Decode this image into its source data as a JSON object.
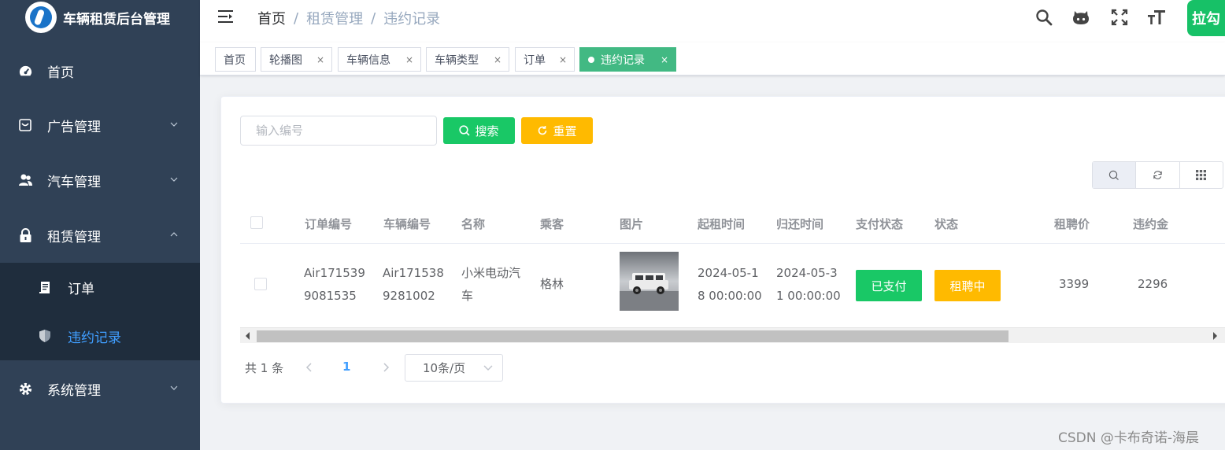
{
  "app": {
    "title": "车辆租赁后台管理"
  },
  "sidebar": {
    "items": [
      {
        "label": "首页",
        "icon": "dashboard-icon"
      },
      {
        "label": "广告管理",
        "icon": "ad-icon"
      },
      {
        "label": "汽车管理",
        "icon": "people-icon"
      },
      {
        "label": "租赁管理",
        "icon": "lock-icon",
        "expanded": true
      },
      {
        "label": "系统管理",
        "icon": "gear-icon"
      }
    ],
    "submenu": [
      {
        "label": "订单",
        "icon": "document-icon"
      },
      {
        "label": "违约记录",
        "icon": "shield-icon",
        "active": true
      }
    ]
  },
  "header": {
    "breadcrumb": [
      "首页",
      "租赁管理",
      "违约记录"
    ],
    "icons": [
      "search-icon",
      "github-icon",
      "fullscreen-icon",
      "font-size-icon"
    ],
    "avatar_text": "拉勾"
  },
  "tags": [
    {
      "label": "首页",
      "closable": false
    },
    {
      "label": "轮播图",
      "closable": true
    },
    {
      "label": "车辆信息",
      "closable": true
    },
    {
      "label": "车辆类型",
      "closable": true
    },
    {
      "label": "订单",
      "closable": true
    },
    {
      "label": "违约记录",
      "closable": true,
      "active": true
    }
  ],
  "tag_close_glyph": "×",
  "search": {
    "placeholder": "输入编号",
    "value": ""
  },
  "buttons": {
    "search_label": "搜索",
    "reset_label": "重置"
  },
  "table": {
    "columns": [
      "订单编号",
      "车辆编号",
      "名称",
      "乘客",
      "图片",
      "起租时间",
      "归还时间",
      "支付状态",
      "状态",
      "租聘价",
      "违约金"
    ],
    "rows": [
      {
        "order_no": [
          "Air171539",
          "9081535"
        ],
        "vehicle_no": [
          "Air171538",
          "9281002"
        ],
        "name": [
          "小米电动汽",
          "车"
        ],
        "passenger": "格林",
        "start_time": [
          "2024-05-1",
          "8 00:00:00"
        ],
        "return_time": [
          "2024-05-3",
          "1 00:00:00"
        ],
        "pay_status": "已支付",
        "status": "租聘中",
        "price": "3399",
        "penalty": "2296"
      }
    ]
  },
  "pagination": {
    "total": "共 1 条",
    "current_page": "1",
    "page_size": "10条/页"
  },
  "watermark": "CSDN @卡布奇诺-海晨",
  "colors": {
    "sidebar_bg": "#304156",
    "submenu_bg": "#1f2d3d",
    "active_menu": "#409eff",
    "tag_active": "#42b983",
    "success": "#19c866",
    "warning": "#ffba00",
    "avatar_bg": "#17c167"
  }
}
